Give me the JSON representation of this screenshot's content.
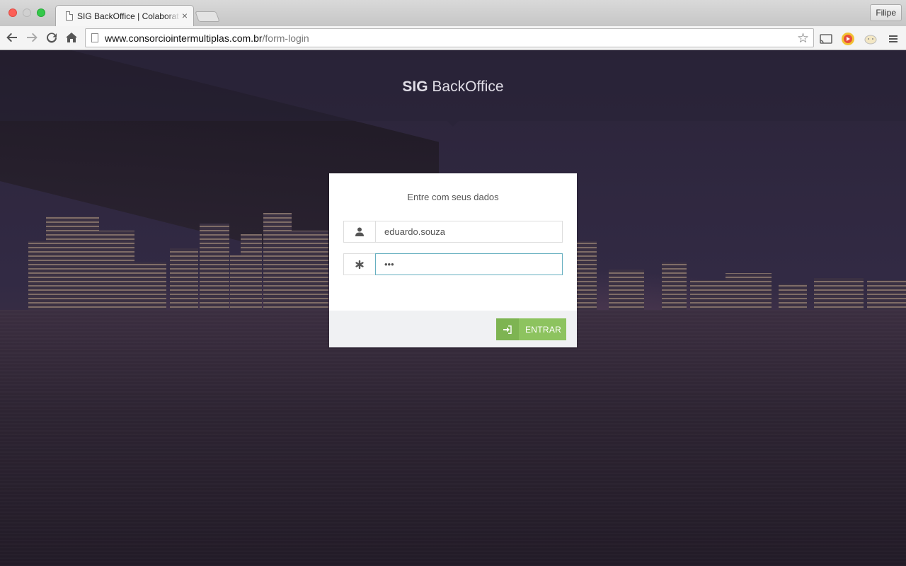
{
  "browser": {
    "tab_title": "SIG BackOffice | Colaborat",
    "profile_name": "Filipe",
    "url_domain": "www.consorciointermultiplas.com.br",
    "url_path": "/form-login"
  },
  "page": {
    "brand_bold": "SIG",
    "brand_rest": " BackOffice",
    "login": {
      "title": "Entre com seus dados",
      "username_value": "eduardo.souza",
      "password_value": "•••",
      "submit_label": "ENTRAR"
    }
  },
  "icons": {
    "user": "user-icon",
    "password": "asterisk-icon",
    "submit": "sign-in-icon"
  },
  "colors": {
    "accent": "#8dc35f",
    "accent_dark": "#7eb452",
    "focus_border": "#66afc0"
  }
}
